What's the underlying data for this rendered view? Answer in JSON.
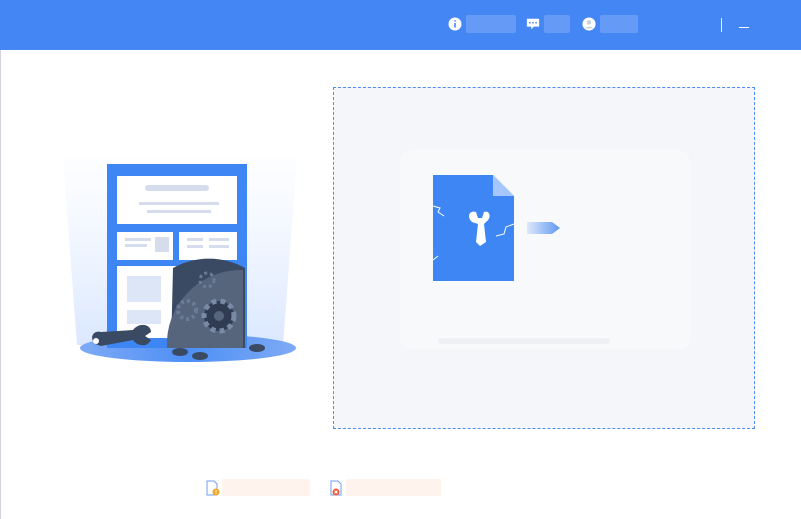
{
  "window": {
    "title": "",
    "accent_color": "#4486f4"
  },
  "toolbar": {
    "info_label": "",
    "feedback_label": "",
    "account_label": ""
  },
  "dropzone": {
    "prompt": "",
    "border_color": "#4f8cf3"
  },
  "file_types": [
    {
      "icon": "file-warning-icon",
      "label": ""
    },
    {
      "icon": "file-error-icon",
      "label": ""
    }
  ]
}
